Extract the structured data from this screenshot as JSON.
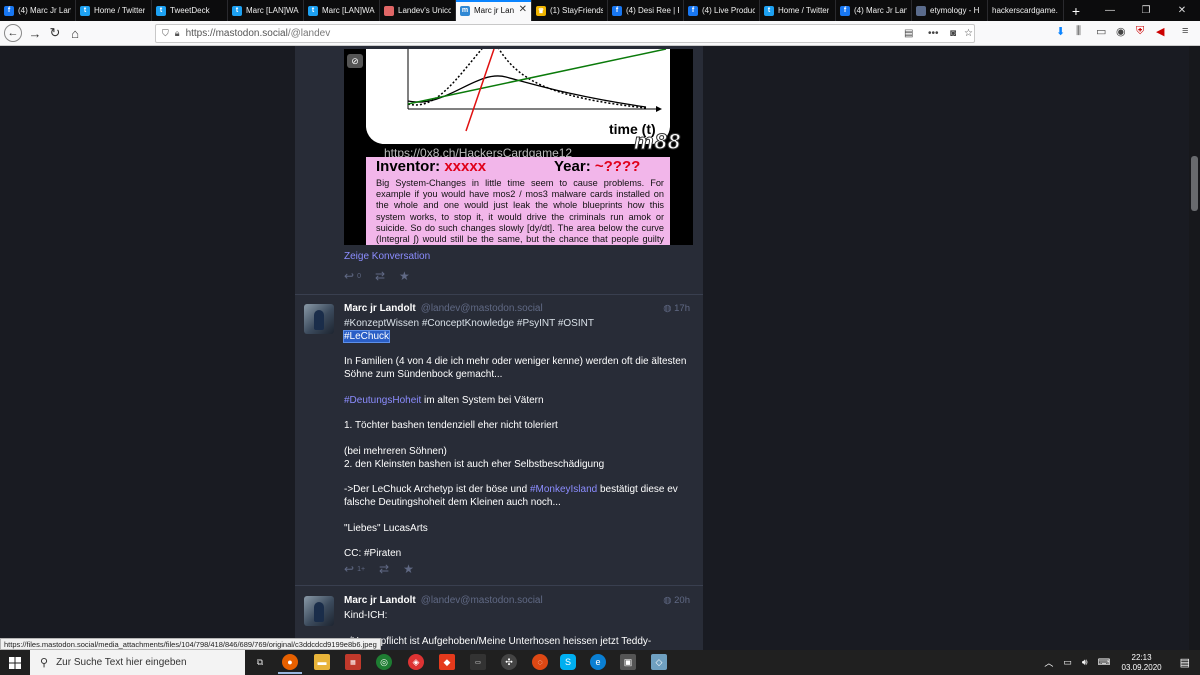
{
  "browser": {
    "tabs": [
      {
        "label": "(4) Marc Jr Lan",
        "icon": "facebook-icon",
        "color": "#1877f2"
      },
      {
        "label": "Home / Twitter",
        "icon": "twitter-icon",
        "color": "#1da1f2"
      },
      {
        "label": "TweetDeck",
        "icon": "tweetdeck-icon",
        "color": "#1da1f2"
      },
      {
        "label": "Marc [LAN]WA",
        "icon": "twitter-icon",
        "color": "#1da1f2"
      },
      {
        "label": "Marc [LAN]WA",
        "icon": "twitter-icon",
        "color": "#1da1f2"
      },
      {
        "label": "Landev's Unicc",
        "icon": "page-icon",
        "color": "#e06666"
      },
      {
        "label": "Marc jr Lan",
        "icon": "mastodon-icon",
        "color": "#3088d4"
      },
      {
        "label": "(1) StayFriends",
        "icon": "stayfriends-icon",
        "color": "#f0b400"
      },
      {
        "label": "(4) Desi Ree | F",
        "icon": "facebook-icon",
        "color": "#1877f2"
      },
      {
        "label": "(4) Live Produc",
        "icon": "facebook-icon",
        "color": "#1877f2"
      },
      {
        "label": "Home / Twitter",
        "icon": "twitter-icon",
        "color": "#1da1f2"
      },
      {
        "label": "(4) Marc Jr Lan",
        "icon": "facebook-icon",
        "color": "#1877f2"
      },
      {
        "label": "etymology - H",
        "icon": "page-icon",
        "color": "#5a6b8c"
      },
      {
        "label": "hackerscardgame.",
        "icon": "",
        "color": ""
      }
    ],
    "url_host": "https://mastodon.social",
    "url_path": "/@landev"
  },
  "card": {
    "axis_label": "time (t)",
    "logo": "m88",
    "url": "https://0x8.ch/HackersCardgame12",
    "inventor_label": "Inventor: ",
    "inventor_value": "xxxxx",
    "year_label": "Year: ",
    "year_value": "~????",
    "text": "Big System-Changes in little time seem to cause problems. For example if you would have mos2 / mos3 malware cards installed on the whole and one would just leak the whole blueprints how this system works, to stop it, it would drive the criminals run amok or suicide. So do such changes slowly [dy/dt]. The area below the curve (Integral ∫) would still be the same, but the chance that people guilty people run amok or even kill their"
  },
  "conversation_link": "Zeige Konversation",
  "toot1": {
    "reply_count": "0"
  },
  "toot2": {
    "author": "Marc jr Landolt",
    "handle": "@landev@mastodon.social",
    "time": "17h",
    "line_tags": "#KonzeptWissen #ConceptKnowledge #PsyINT #OSINT",
    "selected_tag": "#LeChuck",
    "p1": "In Familien (4 von 4 die ich mehr oder weniger kenne) werden oft die ältesten Söhne zum Sündenbock gemacht...",
    "p2_tag": "#DeutungsHoheit",
    "p2_rest": " im alten System bei Vätern",
    "p3": "1. Töchter bashen tendenziell eher nicht toleriert",
    "p4a": "(bei mehreren Söhnen)",
    "p4b": "2. den Kleinsten bashen ist auch eher Selbstbeschädigung",
    "p5_pre": "->Der LeChuck Archetyp ist der böse und ",
    "p5_tag": "#MonkeyIsland",
    "p5_post": " bestätigt diese ev falsche Deutingshoheit dem Kleinen auch noch...",
    "p6": "\"Liebes\" LucasArts",
    "p7": "CC: #Piraten",
    "reply_count": "1+"
  },
  "toot3": {
    "author": "Marc jr Landolt",
    "handle": "@landev@mastodon.social",
    "time": "20h",
    "line1": "Kind-ICH:",
    "line2": "s/Hosenpflicht ist Aufgehoben/Meine Unterhosen heissen jetzt Teddy-"
  },
  "status_url": "https://files.mastodon.social/media_attachments/files/104/798/418/846/689/769/original/c3ddcdcd9199e8b6.jpeg",
  "taskbar": {
    "search_placeholder": "Zur Suche Text hier eingeben",
    "time": "22:13",
    "date": "03.09.2020"
  }
}
